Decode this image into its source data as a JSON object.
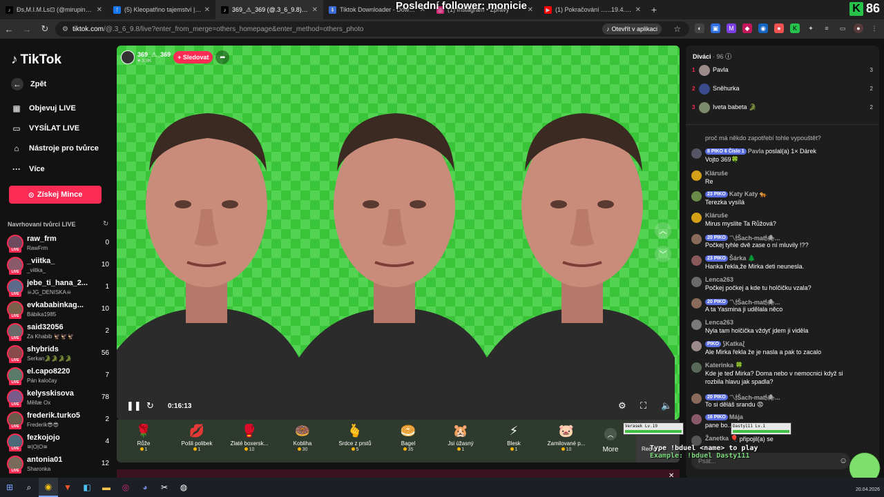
{
  "browser": {
    "overlay_title": "Poslední follower: monicie",
    "tabs": [
      {
        "label": "Đs,M.I.M.Ls⊡ (@mirupink1) |",
        "icon": "tiktok-icon",
        "active": false
      },
      {
        "label": "(5) Kleopatřino tajemství | Faceb",
        "icon": "facebook-icon",
        "active": false
      },
      {
        "label": "369_⚠_369 (@.3_6_9.8) vy",
        "icon": "tiktok-icon",
        "active": true
      },
      {
        "label": "Tiktok Downloader - Download T",
        "icon": "download-icon",
        "active": false
      },
      {
        "label": "(1) Instagram • Zprávy",
        "icon": "instagram-icon",
        "active": false
      },
      {
        "label": "(1) Pokračování ......19.4.2026 - Y",
        "icon": "youtube-icon",
        "active": false
      }
    ],
    "url_host": "tiktok.com",
    "url_path": "/@.3_6_9.8/live?enter_from_merge=others_homepage&enter_method=others_photo",
    "open_in_app": "Otevřít v aplikaci",
    "corner_number": "86"
  },
  "sidebar": {
    "logo": "TikTok",
    "back": "Zpět",
    "nav": [
      {
        "label": "Objevuj LIVE",
        "icon": "live-calendar-icon"
      },
      {
        "label": "VYSÍLAT LIVE",
        "icon": "camera-icon"
      },
      {
        "label": "Nástroje pro tvůrce",
        "icon": "home-tools-icon"
      },
      {
        "label": "Více",
        "icon": "more-dots-icon"
      }
    ],
    "coins_button": "Získej Mince",
    "suggested_title": "Navrhovaní tvůrci LIVE",
    "creators": [
      {
        "name": "raw_frm",
        "sub": "RawFrm",
        "count": "0"
      },
      {
        "name": "_viitka_",
        "sub": "_viitka_",
        "count": "10"
      },
      {
        "name": "jebe_ti_hana_2...",
        "sub": "☠JG_DENISKA☠",
        "count": "1"
      },
      {
        "name": "evkababinkag...",
        "sub": "Bábika1985",
        "count": "10"
      },
      {
        "name": "said32056",
        "sub": "Za Khabib 🦅🦅🦅",
        "count": "2"
      },
      {
        "name": "shybrids",
        "sub": "Serkan🐊🐊🐊🐊",
        "count": "56"
      },
      {
        "name": "el.capo8220",
        "sub": "Pán kaločay",
        "count": "7"
      },
      {
        "name": "kelysskisova",
        "sub": "Měllæ Ox",
        "count": "78"
      },
      {
        "name": "frederik.turko5",
        "sub": "Frederik😎😎",
        "count": "2"
      },
      {
        "name": "fezkojojo",
        "sub": "≋|O|O≋",
        "count": "4"
      },
      {
        "name": "antonia01",
        "sub": "Sharonka",
        "count": "12"
      }
    ]
  },
  "video": {
    "host_name": "369_⚠_369",
    "host_likes": "3.9K",
    "follow_label": "+ Sledovat",
    "timecode": "0:16:13"
  },
  "gifts": {
    "items": [
      {
        "name": "Růže",
        "price": "1",
        "icon": "🌹"
      },
      {
        "name": "Pošli polibek",
        "price": "1",
        "icon": "💋"
      },
      {
        "name": "Zlaté boxersk...",
        "price": "10",
        "icon": "🥊"
      },
      {
        "name": "Kobliha",
        "price": "30",
        "icon": "🍩"
      },
      {
        "name": "Srdce z prstů",
        "price": "5",
        "icon": "🫰"
      },
      {
        "name": "Bagel",
        "price": "35",
        "icon": "🥯"
      },
      {
        "name": "Jsi úžasný",
        "price": "1",
        "icon": "🐹"
      },
      {
        "name": "Blesk",
        "price": "1",
        "icon": "⚡"
      },
      {
        "name": "Zamilované p...",
        "price": "10",
        "icon": "🐷"
      }
    ],
    "more_label": "More",
    "recharge_label": "Rech..."
  },
  "chat": {
    "viewers_label": "Diváci",
    "viewers_count": "· 96",
    "top_viewers": [
      {
        "rank": "1",
        "name": "Pavla",
        "score": "3"
      },
      {
        "rank": "2",
        "name": "Sněhurka",
        "score": "2"
      },
      {
        "rank": "3",
        "name": "Iveta babeta 🐊",
        "score": "2"
      }
    ],
    "messages": [
      {
        "user": "",
        "badges": "",
        "text": "proč má někdo zapotřebí tohle vypouštět?",
        "text2": ""
      },
      {
        "user": "Pavla",
        "badges": "8 PIKO 6 Číslo 1",
        "text": "poslal(a) 1× Dárek",
        "text2": "Vojto 369🍀"
      },
      {
        "user": "Kláruše",
        "badges": "",
        "text": "Re",
        "text2": ""
      },
      {
        "user": "Katy Katy 🐅",
        "badges": "23 PIKO",
        "text": "Terezka vysílá",
        "text2": ""
      },
      {
        "user": "Kláruše",
        "badges": "",
        "text": "Mirus myslíte Ta Růžová?",
        "text2": ""
      },
      {
        "user": "〽🕯Šach-mat🕯🕷...",
        "badges": "20 PIKO",
        "text": "Počkej tyhle dvě zase o ní mluvily !??",
        "text2": ""
      },
      {
        "user": "Šárka 🌲",
        "badges": "23 PIKO",
        "text": "Hanka řekla,že Mirka deti neunesla.",
        "text2": ""
      },
      {
        "user": "Lenca263",
        "badges": "",
        "text": "Počkej počkej a kde tu holčičku vzala?",
        "text2": ""
      },
      {
        "user": "〽🕯Šach-mat🕯🕷...",
        "badges": "20 PIKO",
        "text": "A ta Yasmina ji udělala něco",
        "text2": ""
      },
      {
        "user": "Lenca263",
        "badges": "",
        "text": "Nyla tam holčička vždyť jdem ji viděla",
        "text2": ""
      },
      {
        "user": "⟆Katka⟅",
        "badges": "PIKO",
        "text": "Ale Mirka řekla že je nasla a pak to zacalo",
        "text2": ""
      },
      {
        "user": "Katerinka 🍀",
        "badges": "",
        "text": "Kde je teď Mirka? Doma nebo v nemocnici když si",
        "text2": "rozbila hlavu jak spadla?"
      },
      {
        "user": "〽🕯Šach-mat🕯🕷...",
        "badges": "20 PIKO",
        "text": "To si děláš srandu 😡",
        "text2": ""
      },
      {
        "user": "Mája",
        "badges": "16 PIKO",
        "text": "pane bo...",
        "text2": ""
      },
      {
        "user": "Žanetka 🎈",
        "badges": "",
        "text": "připojil(a) se",
        "text2": ""
      }
    ],
    "input_placeholder": "Psát..."
  },
  "game_overlay": {
    "line1": "Type !bduel <name> to play",
    "line2": "Example: !bduel Dasty111",
    "hp1": "Verasek  Lv.19",
    "hp2": "Dasty111  Lv.1"
  },
  "taskbar": {
    "date": "20.04.2026"
  }
}
